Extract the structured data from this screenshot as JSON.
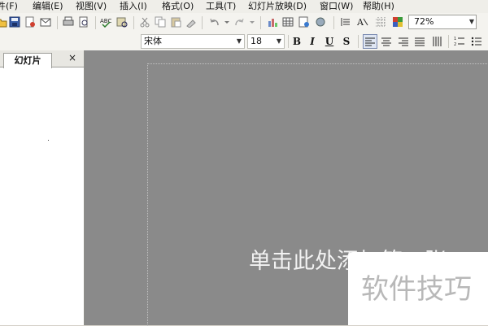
{
  "menubar": {
    "items": [
      {
        "label": "件(F)"
      },
      {
        "label": "编辑(E)"
      },
      {
        "label": "视图(V)"
      },
      {
        "label": "插入(I)"
      },
      {
        "label": "格式(O)"
      },
      {
        "label": "工具(T)"
      },
      {
        "label": "幻灯片放映(D)"
      },
      {
        "label": "窗口(W)"
      },
      {
        "label": "帮助(H)"
      }
    ]
  },
  "toolbar": {
    "zoom_value": "72%"
  },
  "format_toolbar": {
    "font_name": "宋体",
    "font_size": "18",
    "bold_label": "B",
    "italic_label": "I",
    "underline_label": "U",
    "shadow_label": "S"
  },
  "left_pane": {
    "tab_label": "幻灯片",
    "close_label": "×"
  },
  "slide": {
    "placeholder_text": "单击此处添加第一张"
  },
  "watermark": {
    "text": "软件技巧"
  }
}
